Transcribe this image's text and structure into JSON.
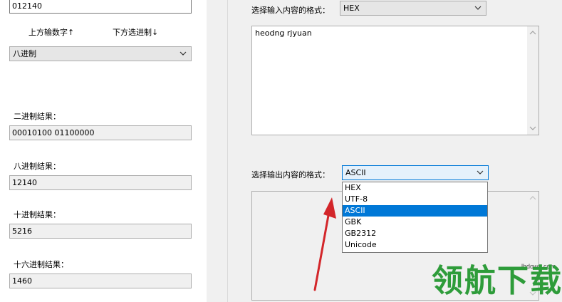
{
  "left": {
    "top_input_value": "012140",
    "up_label": "上方输数字↑",
    "down_label": "下方选进制↓",
    "base_select": "八进制",
    "binary_label": "二进制结果：",
    "binary_value": "00010100 01100000",
    "octal_label": "八进制结果：",
    "octal_value": "12140",
    "decimal_label": "十进制结果：",
    "decimal_value": "5216",
    "hex_label": "十六进制结果：",
    "hex_value": "1460"
  },
  "right": {
    "input_format_label": "选择输入内容的格式：",
    "input_format_value": "HEX",
    "input_text": "heodng rjyuan",
    "output_format_label": "选择输出内容的格式：",
    "output_format_value": "ASCII",
    "output_options": [
      "HEX",
      "UTF-8",
      "ASCII",
      "GBK",
      "GB2312",
      "Unicode"
    ],
    "selected_option_index": 2
  },
  "watermark": {
    "site": "lhdown.com",
    "brand": "领航下载"
  },
  "colors": {
    "selection": "#0078d7",
    "arrow": "#d3262a",
    "brand": "#2e9c3a"
  }
}
